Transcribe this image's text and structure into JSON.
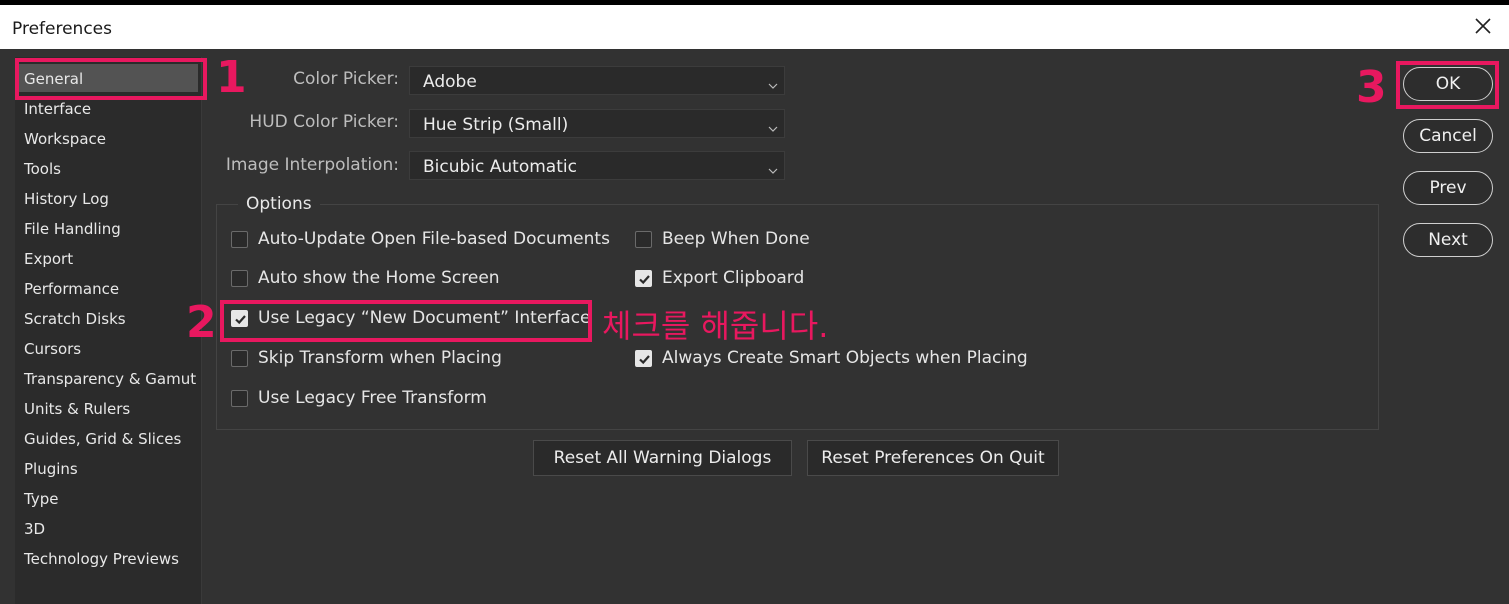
{
  "window": {
    "title": "Preferences"
  },
  "sidebar": {
    "items": [
      {
        "label": "General"
      },
      {
        "label": "Interface"
      },
      {
        "label": "Workspace"
      },
      {
        "label": "Tools"
      },
      {
        "label": "History Log"
      },
      {
        "label": "File Handling"
      },
      {
        "label": "Export"
      },
      {
        "label": "Performance"
      },
      {
        "label": "Scratch Disks"
      },
      {
        "label": "Cursors"
      },
      {
        "label": "Transparency & Gamut"
      },
      {
        "label": "Units & Rulers"
      },
      {
        "label": "Guides, Grid & Slices"
      },
      {
        "label": "Plugins"
      },
      {
        "label": "Type"
      },
      {
        "label": "3D"
      },
      {
        "label": "Technology Previews"
      }
    ],
    "selected": "General"
  },
  "fields": {
    "color_picker": {
      "label": "Color Picker:",
      "value": "Adobe"
    },
    "hud_color_picker": {
      "label": "HUD Color Picker:",
      "value": "Hue Strip (Small)"
    },
    "image_interpolation": {
      "label": "Image Interpolation:",
      "value": "Bicubic Automatic"
    }
  },
  "options": {
    "title": "Options",
    "left": [
      {
        "label": "Auto-Update Open File-based Documents",
        "checked": false
      },
      {
        "label": "Auto show the Home Screen",
        "checked": false
      },
      {
        "label": "Use Legacy “New Document” Interface",
        "checked": true
      },
      {
        "label": "Skip Transform when Placing",
        "checked": false
      },
      {
        "label": "Use Legacy Free Transform",
        "checked": false
      }
    ],
    "right": [
      {
        "label": "Beep When Done",
        "checked": false
      },
      {
        "label": "Export Clipboard",
        "checked": true
      },
      {
        "label": "Always Create Smart Objects when Placing",
        "checked": true
      }
    ]
  },
  "reset_buttons": {
    "warnings": "Reset All Warning Dialogs",
    "on_quit": "Reset Preferences On Quit"
  },
  "action_buttons": {
    "ok": "OK",
    "cancel": "Cancel",
    "prev": "Prev",
    "next": "Next"
  },
  "annotations": {
    "step1": "1",
    "step2": "2",
    "step3": "3",
    "note": "체크를 해줍니다.",
    "color": "#e8185f"
  },
  "colors": {
    "background": "#323232",
    "sidebar": "#2b2b2b",
    "selection": "#535353"
  }
}
